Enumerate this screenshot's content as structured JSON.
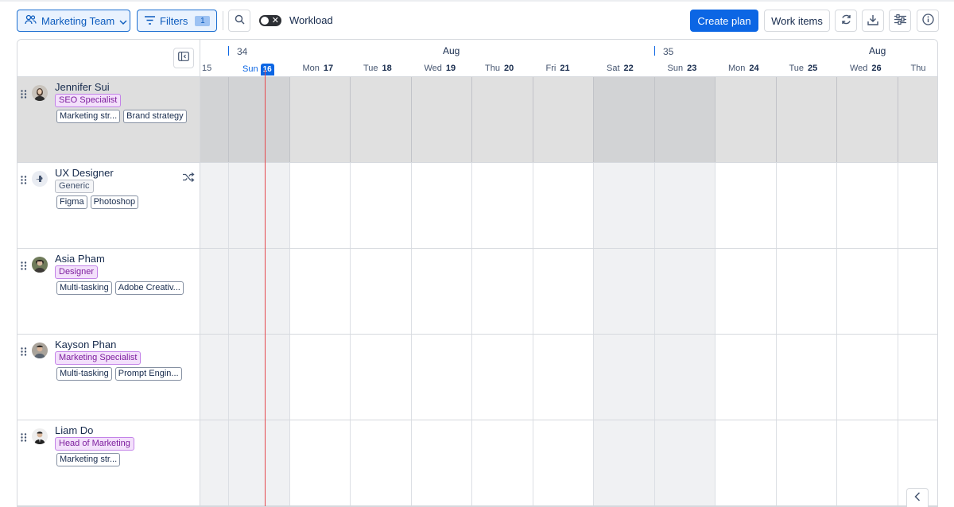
{
  "toolbar": {
    "team_label": "Marketing Team",
    "filters_label": "Filters",
    "filters_count": "1",
    "workload_label": "Workload",
    "workload_on": false,
    "create_plan_label": "Create plan",
    "work_items_label": "Work items"
  },
  "colors": {
    "primary": "#0c66e4",
    "today_line": "#e5484d",
    "role_bg": "#f3e0fb",
    "role_border": "#c383e8"
  },
  "timeline": {
    "weeks": [
      "34",
      "35"
    ],
    "months": [
      "Aug",
      "Aug"
    ],
    "days": [
      {
        "dow": "",
        "num": "15",
        "weekend": true
      },
      {
        "dow": "Sun",
        "num": "16",
        "weekend": true,
        "today": true
      },
      {
        "dow": "Mon",
        "num": "17",
        "weekend": false
      },
      {
        "dow": "Tue",
        "num": "18",
        "weekend": false
      },
      {
        "dow": "Wed",
        "num": "19",
        "weekend": false
      },
      {
        "dow": "Thu",
        "num": "20",
        "weekend": false
      },
      {
        "dow": "Fri",
        "num": "21",
        "weekend": false
      },
      {
        "dow": "Sat",
        "num": "22",
        "weekend": true
      },
      {
        "dow": "Sun",
        "num": "23",
        "weekend": true
      },
      {
        "dow": "Mon",
        "num": "24",
        "weekend": false
      },
      {
        "dow": "Tue",
        "num": "25",
        "weekend": false
      },
      {
        "dow": "Wed",
        "num": "26",
        "weekend": false
      },
      {
        "dow": "Thu",
        "num": "",
        "weekend": false
      }
    ]
  },
  "people": [
    {
      "name": "Jennifer Sui",
      "role": "SEO Specialist",
      "skills": [
        "Marketing str...",
        "Brand strategy"
      ],
      "selected": true,
      "avatar": "photo"
    },
    {
      "name": "UX Designer",
      "role": "Generic",
      "skills": [
        "Figma",
        "Photoshop"
      ],
      "selected": false,
      "avatar": "puzzle-icon"
    },
    {
      "name": "Asia Pham",
      "role": "Designer",
      "skills": [
        "Multi-tasking",
        "Adobe Creativ..."
      ],
      "selected": false,
      "avatar": "photo"
    },
    {
      "name": "Kayson Phan",
      "role": "Marketing Specialist",
      "skills": [
        "Multi-tasking",
        "Prompt Engin..."
      ],
      "selected": false,
      "avatar": "photo"
    },
    {
      "name": "Liam Do",
      "role": "Head of Marketing",
      "skills": [
        "Marketing str..."
      ],
      "selected": false,
      "avatar": "photo"
    }
  ]
}
